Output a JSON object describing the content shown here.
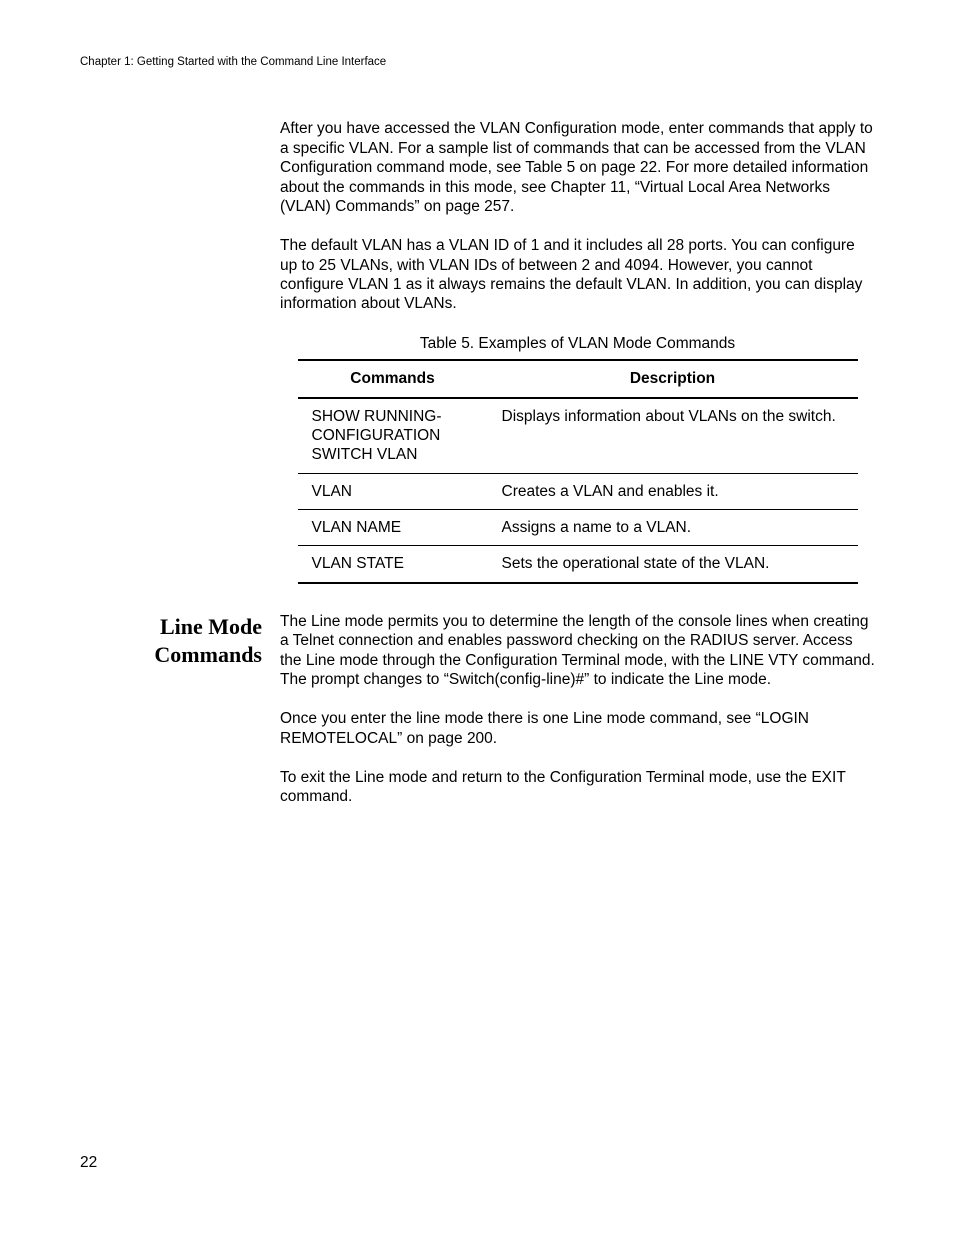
{
  "running_header": "Chapter 1: Getting Started with the Command Line Interface",
  "para1": "After you have accessed the VLAN Configuration mode, enter commands that apply to a specific VLAN. For a sample list of commands that can be accessed from the VLAN Configuration command mode, see Table 5 on page 22. For more detailed information about the commands in this mode, see Chapter 11, “Virtual Local Area Networks (VLAN) Commands” on page 257.",
  "para2": "The default VLAN has a VLAN ID of 1 and it includes all 28 ports. You can configure up to 25 VLANs, with VLAN IDs of between 2 and 4094. However, you cannot configure VLAN 1 as it always remains the default VLAN. In addition, you can display information about VLANs.",
  "table_caption": "Table 5. Examples of VLAN Mode Commands",
  "table": {
    "headers": {
      "col1": "Commands",
      "col2": "Description"
    },
    "rows": [
      {
        "cmd": "SHOW RUNNING-CONFIGURATION SWITCH VLAN",
        "desc": "Displays information about VLANs on the switch."
      },
      {
        "cmd": "VLAN",
        "desc": "Creates a VLAN and enables it."
      },
      {
        "cmd": "VLAN NAME",
        "desc": "Assigns a name to a VLAN."
      },
      {
        "cmd": "VLAN STATE",
        "desc": "Sets the operational state of the VLAN."
      }
    ]
  },
  "section_heading": "Line Mode Commands",
  "para3": "The Line mode permits you to determine the length of the console lines when creating a Telnet connection and enables password checking on the RADIUS server. Access the Line mode through the Configuration Terminal mode, with the LINE VTY command. The prompt changes to “Switch(config-line)#” to indicate the Line mode.",
  "para4": "Once you enter the line mode there is one Line mode command, see “LOGIN REMOTELOCAL” on page 200.",
  "para5": "To exit the Line mode and return to the Configuration Terminal mode, use the EXIT command.",
  "page_number": "22"
}
